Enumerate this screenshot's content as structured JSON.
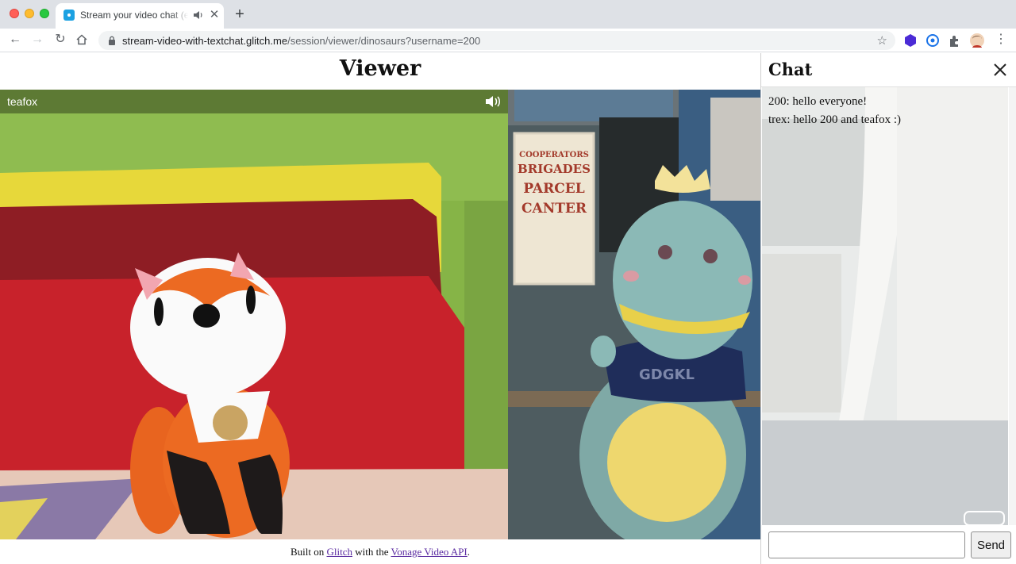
{
  "browser": {
    "tab_title": "Stream your video chat (en",
    "new_tab_symbol": "+",
    "url_host": "stream-video-with-textchat.glitch.me",
    "url_path": "/session/viewer/dinosaurs?username=200",
    "icons": [
      "back-icon",
      "forward-icon",
      "reload-icon",
      "home-icon",
      "lock-icon",
      "star-icon",
      "extension-icon",
      "profile-avatar"
    ]
  },
  "page": {
    "title": "Viewer"
  },
  "videos": [
    {
      "name": "teafox"
    },
    {
      "name": ""
    }
  ],
  "footer": {
    "prefix": "Built on",
    "glitch_link": "Glitch",
    "middle": "with the",
    "api_link": "Vonage Video API",
    "suffix": "."
  },
  "chat": {
    "title": "Chat",
    "messages": [
      {
        "text": "200: hello everyone!"
      },
      {
        "text": "trex: hello 200 and teafox :)"
      }
    ],
    "input_value": "",
    "send_label": "Send"
  },
  "colors": {
    "link": "#5a2ba1",
    "tab_bar": "#dee1e6",
    "fox_wall": "#7fae3f",
    "dino_wall": "#48565a"
  }
}
